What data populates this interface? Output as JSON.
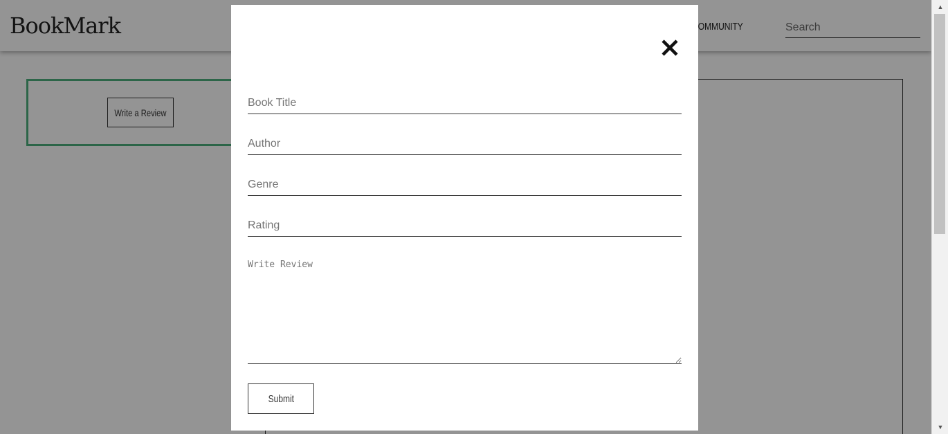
{
  "header": {
    "logo": "BookMark",
    "nav_community": "COMMUNITY",
    "search_placeholder": "Search"
  },
  "main": {
    "write_review_button": "Write a Review"
  },
  "modal": {
    "fields": {
      "book_title_placeholder": "Book Title",
      "author_placeholder": "Author",
      "genre_placeholder": "Genre",
      "rating_placeholder": "Rating",
      "review_placeholder": "Write Review"
    },
    "submit_label": "Submit",
    "close_icon": "close-icon"
  },
  "colors": {
    "accent_green": "#4caf7d",
    "overlay": "rgba(0,0,0,0.42)"
  }
}
